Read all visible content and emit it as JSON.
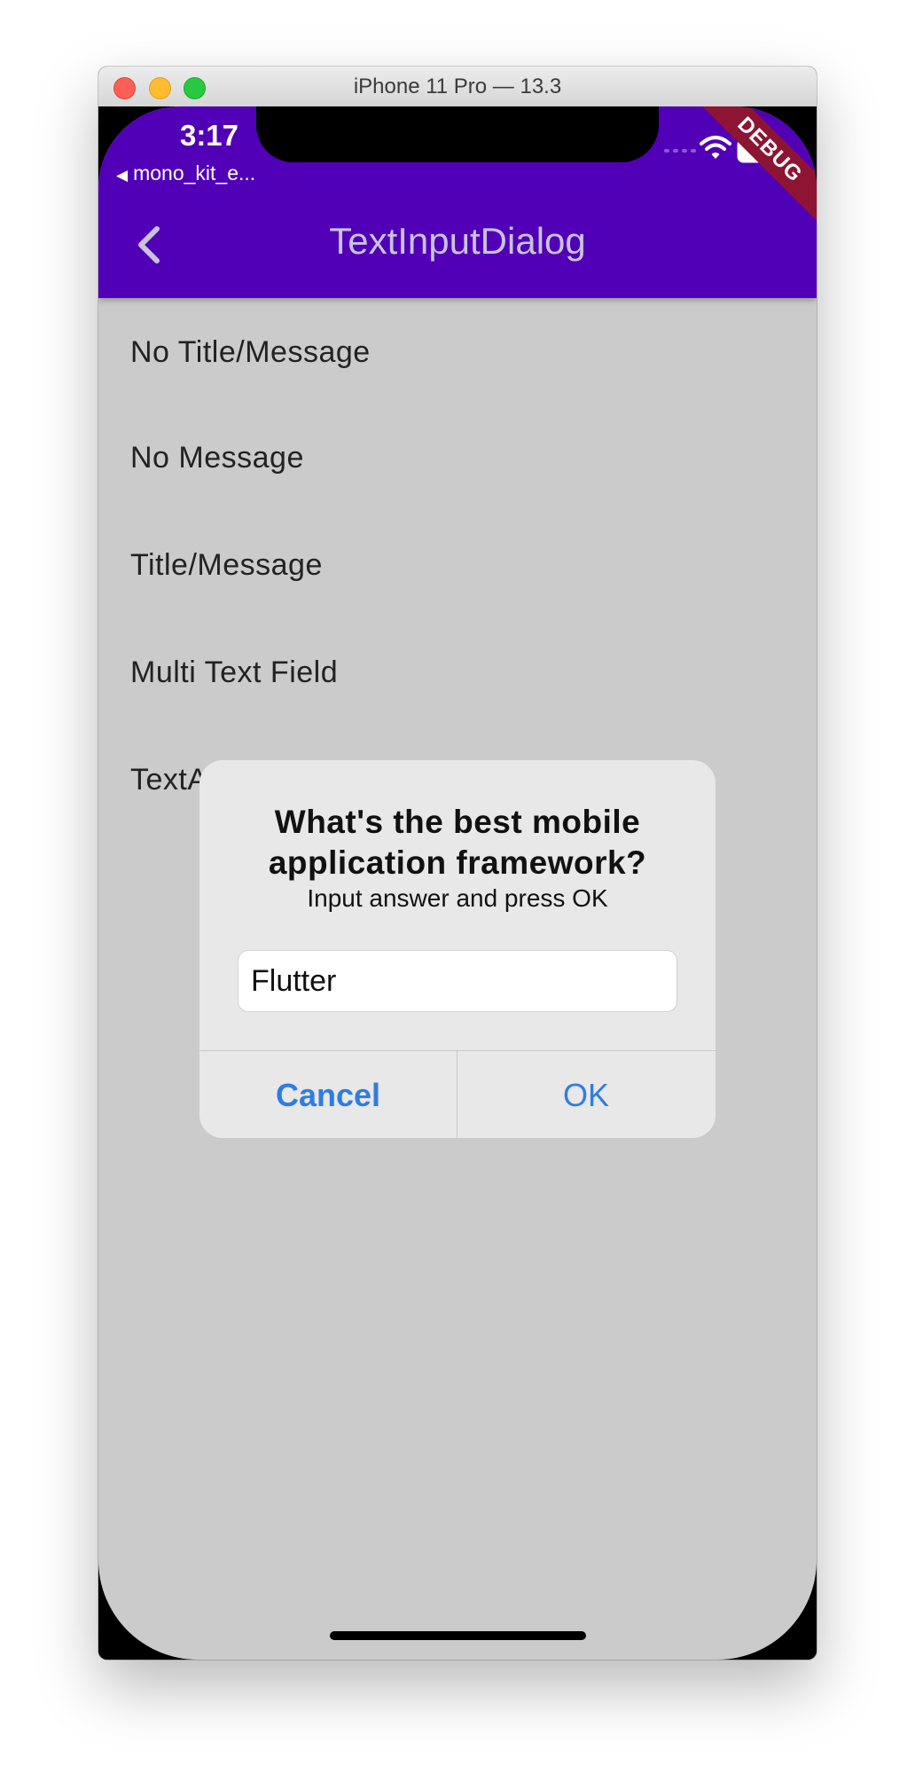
{
  "window": {
    "title": "iPhone 11 Pro — 13.3"
  },
  "status_bar": {
    "time": "3:17",
    "back_app": "mono_kit_e...",
    "debug_banner": "DEBUG"
  },
  "app_bar": {
    "title": "TextInputDialog"
  },
  "list": {
    "items": [
      "No Title/Message",
      "No Message",
      "Title/Message",
      "Multi Text Field",
      "TextA"
    ]
  },
  "dialog": {
    "title_line1": "What's the best mobile",
    "title_line2": "application framework?",
    "message": "Input answer and press OK",
    "input_value": "Flutter",
    "cancel_label": "Cancel",
    "ok_label": "OK"
  },
  "colors": {
    "app_bar": "#5100b7",
    "screen_bg": "#cbcbcb",
    "dialog_bg": "#e8e8e8",
    "action_blue": "#2f7de3",
    "debug_banner": "#8e1433"
  }
}
